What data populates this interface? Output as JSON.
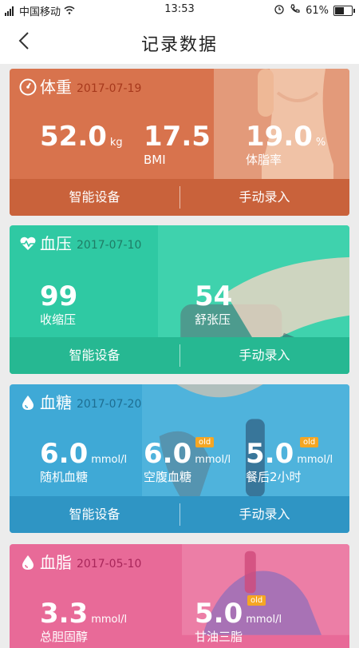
{
  "status": {
    "carrier": "中国移动",
    "time": "13:53",
    "battery": "61%",
    "battery_level": 0.61,
    "network_tag": "4G"
  },
  "nav": {
    "title": "记录数据",
    "back_icon": "chevron-left-icon"
  },
  "buttons": {
    "device": "智能设备",
    "manual": "手动录入"
  },
  "cards": {
    "weight": {
      "name": "体重",
      "date": "2017-07-19",
      "color": "#d8734d",
      "icon": "speedometer-icon",
      "weight": {
        "value": "52.0",
        "unit": "kg"
      },
      "bmi": {
        "value": "17.5",
        "label": "BMI"
      },
      "fat": {
        "value": "19.0",
        "unit": "%",
        "label": "体脂率"
      }
    },
    "pressure": {
      "name": "血压",
      "date": "2017-07-10",
      "color": "#2fc9a3",
      "icon": "heart-pulse-icon",
      "systolic": {
        "value": "99",
        "label": "收缩压"
      },
      "diastolic": {
        "value": "54",
        "label": "舒张压"
      }
    },
    "sugar": {
      "name": "血糖",
      "date": "2017-07-20",
      "color": "#3fa9d6",
      "icon": "drop-icon",
      "random": {
        "value": "6.0",
        "unit": "mmol/l",
        "label": "随机血糖"
      },
      "fasting": {
        "value": "6.0",
        "unit": "mmol/l",
        "label": "空腹血糖",
        "badge": "old"
      },
      "after": {
        "value": "5.0",
        "unit": "mmol/l",
        "label": "餐后2小时",
        "badge": "old"
      }
    },
    "lipid": {
      "name": "血脂",
      "date": "2017-05-10",
      "color": "#e86a98",
      "icon": "drop-icon",
      "cholesterol": {
        "value": "3.3",
        "unit": "mmol/l",
        "label": "总胆固醇"
      },
      "triglyceride": {
        "value": "5.0",
        "unit": "mmol/l",
        "label": "甘油三脂",
        "badge": "old"
      }
    }
  }
}
